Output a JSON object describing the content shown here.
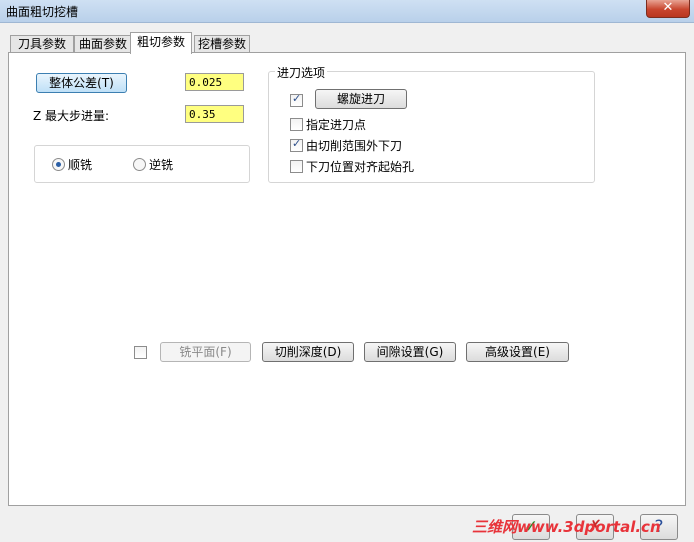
{
  "window": {
    "title": "曲面粗切挖槽",
    "close_glyph": "✕"
  },
  "tabs": [
    {
      "label": "刀具参数",
      "active": false
    },
    {
      "label": "曲面参数",
      "active": false
    },
    {
      "label": "粗切参数",
      "active": true
    },
    {
      "label": "挖槽参数",
      "active": false
    }
  ],
  "rough": {
    "tolerance_button": "整体公差(T)",
    "tolerance_value": "0.025",
    "max_step_label": "Z 最大步进量:",
    "max_step_value": "0.35",
    "climb_label": "顺铣",
    "conventional_label": "逆铣",
    "selected": "climb"
  },
  "entry": {
    "caption": "进刀选项",
    "helix_checked": true,
    "helix_button": "螺旋进刀",
    "options": [
      {
        "label": "指定进刀点",
        "checked": false
      },
      {
        "label": "由切削范围外下刀",
        "checked": true
      },
      {
        "label": "下刀位置对齐起始孔",
        "checked": false
      }
    ]
  },
  "bottom": {
    "facing_checked": false,
    "facing_button": "铣平面(F)",
    "depth_button": "切削深度(D)",
    "gap_button": "间隙设置(G)",
    "advanced_button": "高级设置(E)"
  },
  "dialog_buttons": {
    "ok": "✓",
    "cancel": "✗",
    "help": "?"
  },
  "watermark": "三维网www.3dportal.cn",
  "colors": {
    "field_bg": "#ffff80",
    "titlebar": "#b9d0ea",
    "close": "#c8452e"
  }
}
